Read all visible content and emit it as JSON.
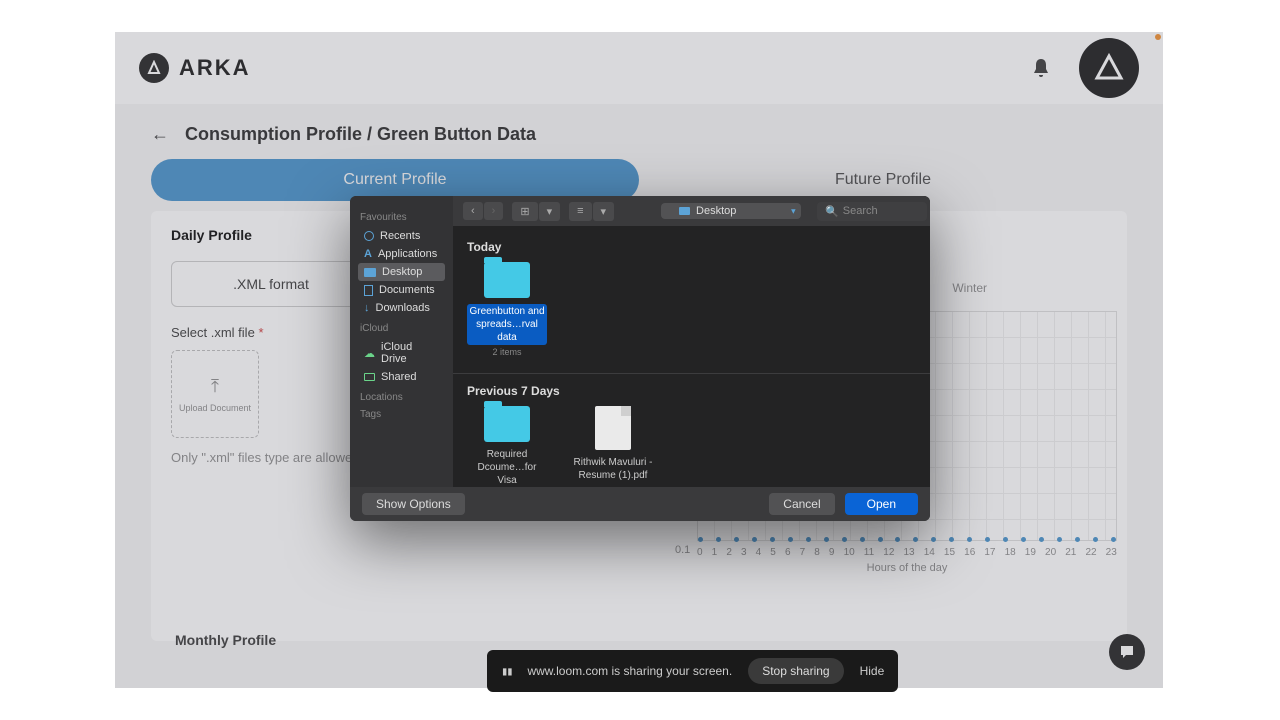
{
  "header": {
    "brand": "ARKA"
  },
  "breadcrumb": {
    "back_glyph": "←",
    "text": "Consumption Profile / Green Button Data"
  },
  "tabs": {
    "current": "Current Profile",
    "future": "Future Profile"
  },
  "daily": {
    "heading": "Daily Profile",
    "xml_btn": ".XML format",
    "select_label": "Select .xml file",
    "required_mark": "*",
    "upload_label": "Upload Document",
    "hint": "Only \".xml\" files type are allowed",
    "season": "Winter"
  },
  "chart_data": {
    "type": "line",
    "x": [
      0,
      1,
      2,
      3,
      4,
      5,
      6,
      7,
      8,
      9,
      10,
      11,
      12,
      13,
      14,
      15,
      16,
      17,
      18,
      19,
      20,
      21,
      22,
      23
    ],
    "values": [
      0,
      0,
      0,
      0,
      0,
      0,
      0,
      0,
      0,
      0,
      0,
      0,
      0,
      0,
      0,
      0,
      0,
      0,
      0,
      0,
      0,
      0,
      0,
      0
    ],
    "ylabel_value": "0.1",
    "xlabel": "Hours of the day",
    "ylim": [
      0,
      0.1
    ],
    "color": "#3f8ec9"
  },
  "monthly": {
    "heading": "Monthly Profile"
  },
  "dialog": {
    "sidebar": {
      "favourites_head": "Favourites",
      "recents": "Recents",
      "applications": "Applications",
      "desktop": "Desktop",
      "documents": "Documents",
      "downloads": "Downloads",
      "icloud_head": "iCloud",
      "icloud_drive": "iCloud Drive",
      "shared": "Shared",
      "locations_head": "Locations",
      "tags_head": "Tags"
    },
    "toolbar": {
      "back_glyph": "‹",
      "fwd_glyph": "›",
      "view_glyph": "⊞",
      "list_glyph": "≡",
      "location": "Desktop",
      "search_placeholder": "Search",
      "search_icon": "🔍"
    },
    "sections": {
      "today": "Today",
      "previous": "Previous 7 Days"
    },
    "files": {
      "greenbutton_name": "Greenbutton and spreads…rval data",
      "greenbutton_meta": "2 items",
      "required_name": "Required Dcoume…for Visa",
      "rithwik_name": "Rithwik Mavuluri - Resume (1).pdf"
    },
    "footer": {
      "show_options": "Show Options",
      "cancel": "Cancel",
      "open": "Open"
    }
  },
  "loom": {
    "text": "www.loom.com is sharing your screen.",
    "stop": "Stop sharing",
    "hide": "Hide"
  }
}
